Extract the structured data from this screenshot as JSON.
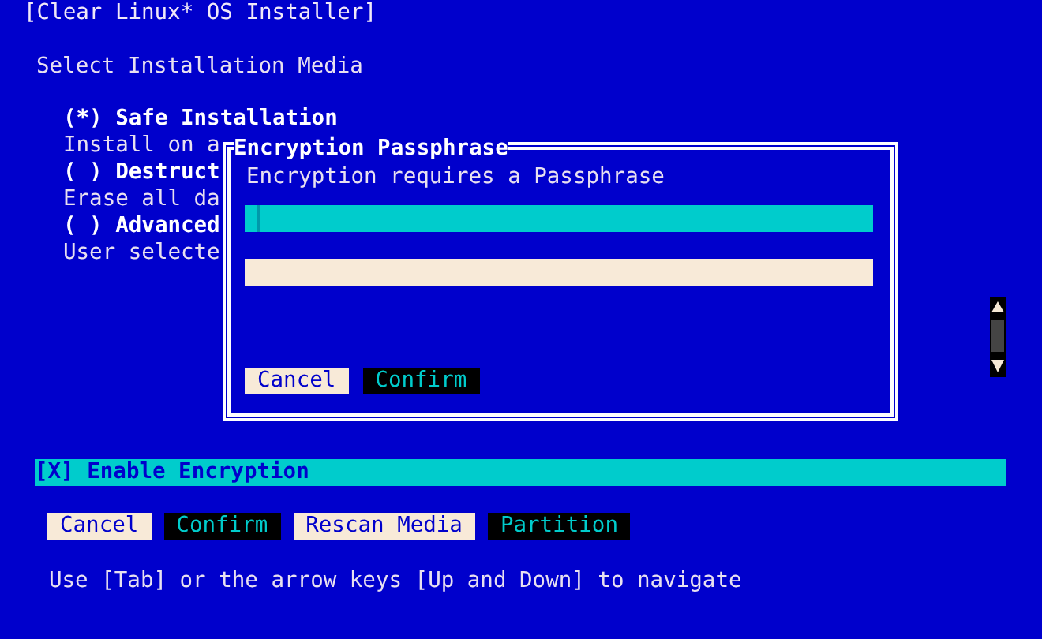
{
  "window": {
    "title": "[Clear Linux* OS Installer]"
  },
  "heading": "Select Installation Media",
  "options": [
    {
      "marker": "(*)",
      "label": "Safe Installation",
      "description": "Install on a"
    },
    {
      "marker": "( )",
      "label": "Destruct",
      "description": "Erase all da"
    },
    {
      "marker": "( )",
      "label": "Advanced",
      "description": "User selecte"
    }
  ],
  "encryption_checkbox": {
    "label": "[X] Enable Encryption",
    "focused": true
  },
  "buttons": [
    {
      "label": "Cancel",
      "kind": "light"
    },
    {
      "label": "Confirm",
      "kind": "dark"
    },
    {
      "label": "Rescan Media",
      "kind": "light"
    },
    {
      "label": "Partition",
      "kind": "dark"
    }
  ],
  "help": "Use [Tab] or the arrow keys [Up and Down] to navigate",
  "dialog": {
    "title": "Encryption Passphrase",
    "message": "Encryption requires a Passphrase",
    "fields": [
      {
        "focused": true
      },
      {
        "focused": false
      }
    ],
    "buttons": [
      {
        "label": "Cancel",
        "kind": "light"
      },
      {
        "label": "Confirm",
        "kind": "dark"
      }
    ]
  }
}
